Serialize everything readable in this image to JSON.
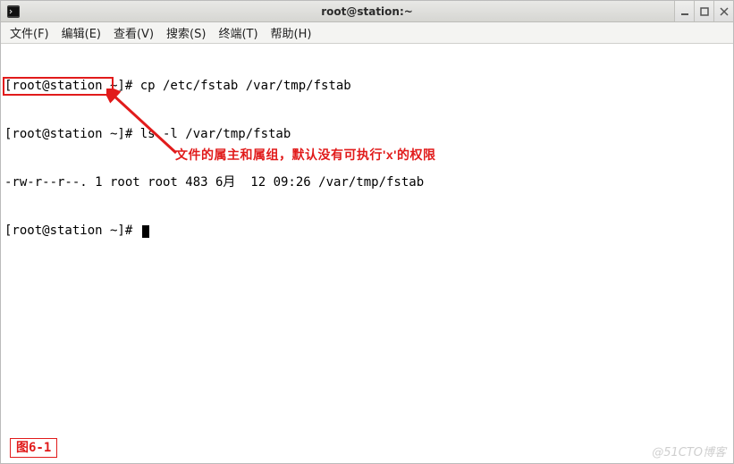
{
  "window": {
    "title": "root@station:~",
    "icon_name": "terminal-icon"
  },
  "menubar": {
    "items": [
      "文件(F)",
      "编辑(E)",
      "查看(V)",
      "搜索(S)",
      "终端(T)",
      "帮助(H)"
    ]
  },
  "terminal": {
    "lines": [
      "[root@station ~]# cp /etc/fstab /var/tmp/fstab",
      "[root@station ~]# ls -l /var/tmp/fstab",
      "-rw-r--r--. 1 root root 483 6月  12 09:26 /var/tmp/fstab",
      "[root@station ~]# "
    ],
    "cursor_line_index": 3
  },
  "annotation": {
    "text": "文件的属主和属组，默认没有可执行'x'的权限"
  },
  "figure_label": "图6-1",
  "watermark": "@51CTO博客",
  "colors": {
    "highlight_red": "#e11b1b"
  }
}
